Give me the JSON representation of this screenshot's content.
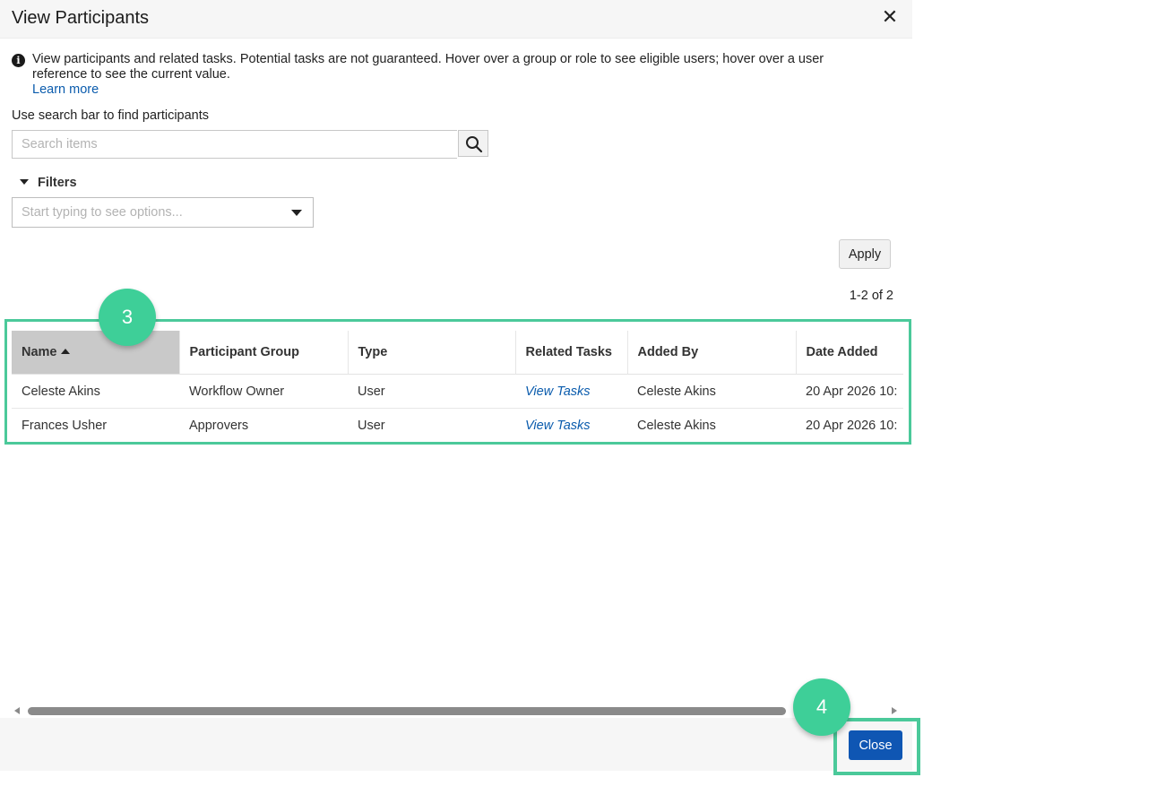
{
  "dialog": {
    "title": "View Participants",
    "close_glyph": "✕"
  },
  "info": {
    "icon": "info-icon",
    "icon_glyph": "i",
    "text": "View participants and related tasks. Potential tasks are not guaranteed. Hover over a group or role to see eligible users; hover over a user reference to see the current value.",
    "learn_more": "Learn more"
  },
  "search": {
    "label": "Use search bar to find participants",
    "placeholder": "Search items",
    "value": "",
    "icon": "search-icon"
  },
  "filters": {
    "label": "Filters",
    "placeholder": "Start typing to see options...",
    "apply_label": "Apply"
  },
  "pager": {
    "text": "1-2 of 2"
  },
  "table": {
    "columns": [
      "Name",
      "Participant Group",
      "Type",
      "Related Tasks",
      "Added By",
      "Date Added"
    ],
    "sorted_column": "Name",
    "sort_direction": "ascending",
    "rows": [
      [
        "Celeste Akins",
        "Workflow Owner",
        "User",
        "View Tasks",
        "Celeste Akins",
        "20 Apr 2026 10:"
      ],
      [
        "Frances Usher",
        "Approvers",
        "User",
        "View Tasks",
        "Celeste Akins",
        "20 Apr 2026 10:"
      ]
    ]
  },
  "annotations": {
    "step_table": "3",
    "step_close": "4",
    "highlight_color": "#4bc99a",
    "badge_color": "#3ecf98"
  },
  "footer": {
    "close_label": "Close"
  },
  "colors": {
    "primary_button": "#0f56b3",
    "link": "#0b5cad"
  }
}
